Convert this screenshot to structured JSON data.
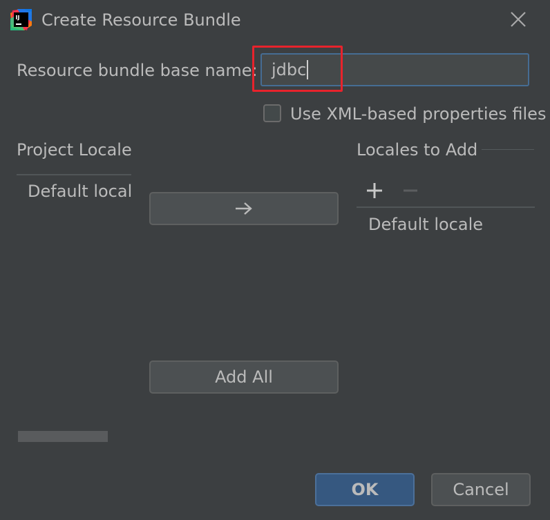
{
  "window": {
    "title": "Create Resource Bundle",
    "app_icon": "intellij-idea-icon",
    "logo_text": "IJ"
  },
  "form": {
    "base_name_label": "Resource bundle base name:",
    "base_name_value": "jdbc",
    "use_xml_label": "Use XML-based properties files",
    "use_xml_checked": false
  },
  "project_locales": {
    "title": "Project Locales",
    "items": [
      "Default locale"
    ]
  },
  "locales_to_add": {
    "title": "Locales to Add",
    "items": [
      "Default locale"
    ],
    "add_icon": "plus-icon",
    "remove_icon": "minus-icon"
  },
  "middle": {
    "move_icon": "arrow-right-icon",
    "add_all_label": "Add All"
  },
  "buttons": {
    "ok": "OK",
    "cancel": "Cancel"
  },
  "colors": {
    "background": "#3c3f41",
    "accent": "#365880",
    "focus_border": "#466d94",
    "highlight": "#e8232c"
  }
}
